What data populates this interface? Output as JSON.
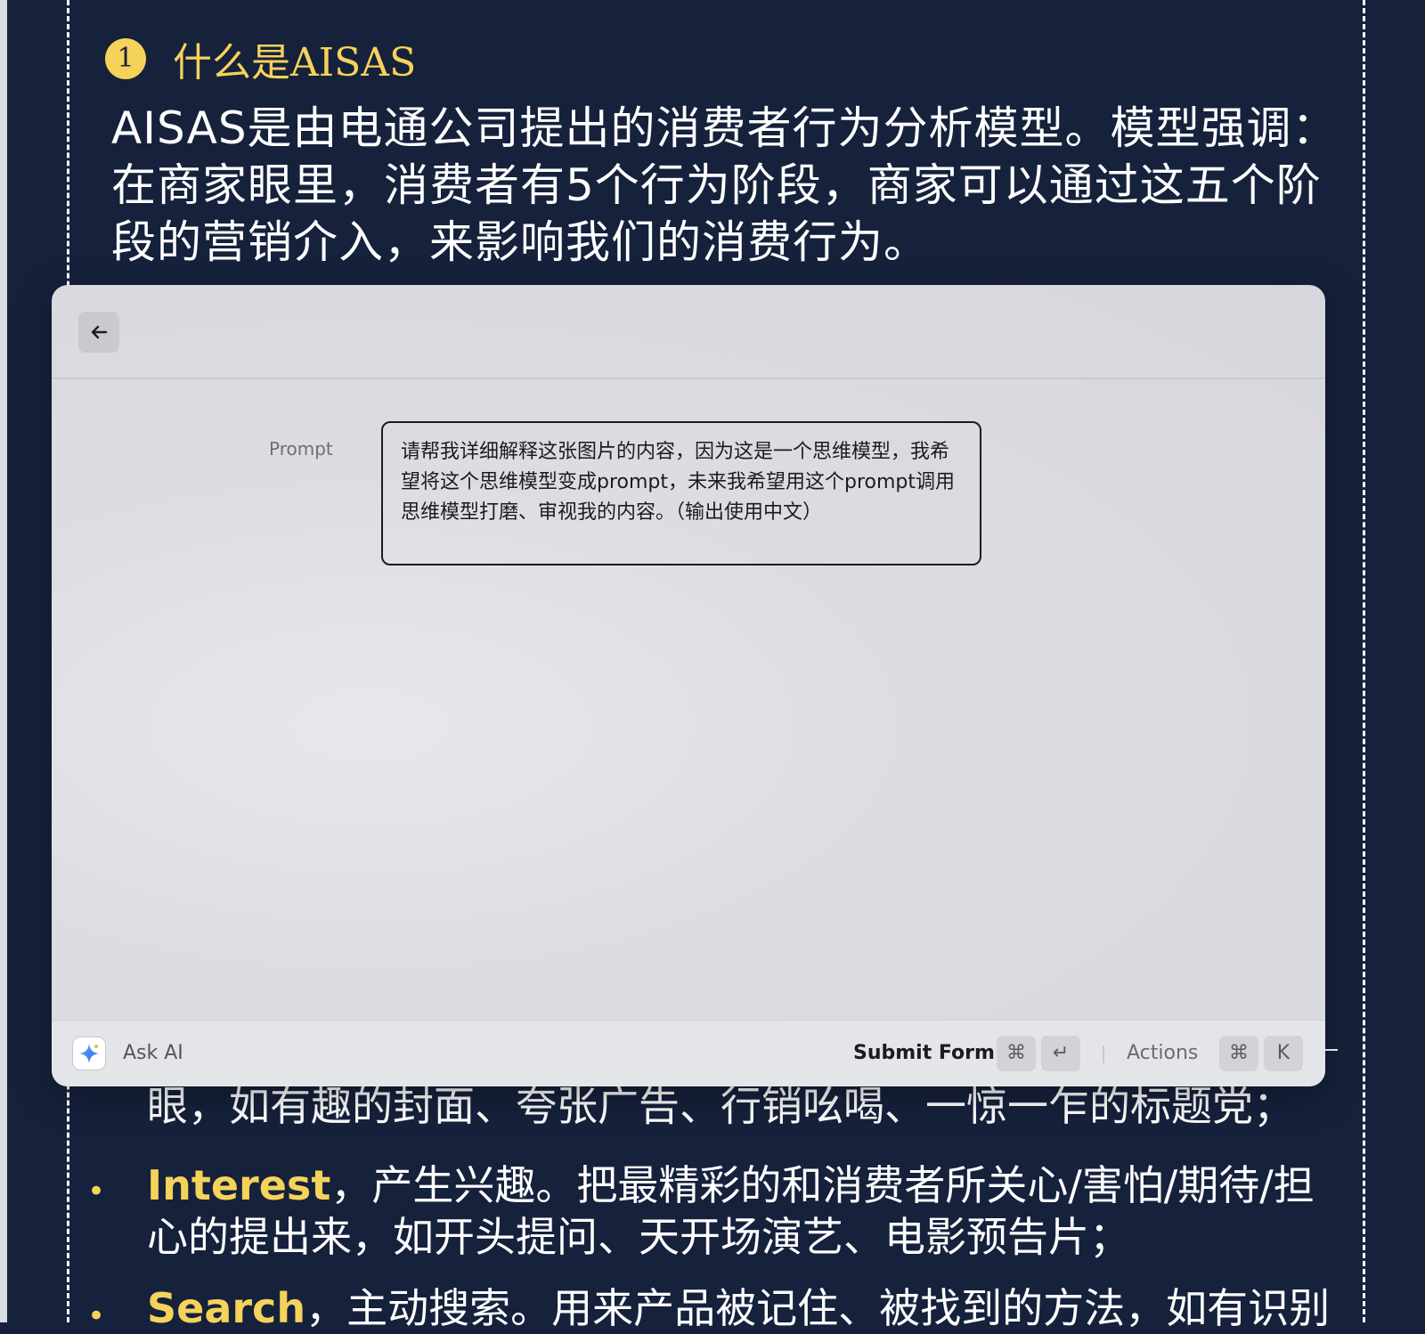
{
  "document": {
    "section_number": "1",
    "section_title": "什么是AISAS",
    "intro": "AISAS是由电通公司提出的消费者行为分析模型。模型强调：在商家眼里，消费者有5个行为阶段，商家可以通过这五个阶段的营销介入，来影响我们的消费行为。",
    "partial_line": "眼，如有趣的封面、夸张广告、行销吆喝、一惊一乍的标题党；",
    "bullets": [
      {
        "keyword": "Interest",
        "text": "，产生兴趣。把最精彩的和消费者所关心/害怕/期待/担心的提出来，如开头提问、天开场演艺、电影预告片；"
      },
      {
        "keyword": "Search",
        "text": "，主动搜索。用来产品被记住、被找到的方法，如有识别"
      }
    ]
  },
  "window": {
    "prompt_label": "Prompt",
    "prompt_value": "请帮我详细解释这张图片的内容，因为这是一个思维模型，我希望将这个思维模型变成prompt，未来我希望用这个prompt调用思维模型打磨、审视我的内容。（输出使用中文）",
    "footer": {
      "ask_ai": "Ask AI",
      "submit_form": "Submit Form",
      "submit_keys": [
        "⌘",
        "↵"
      ],
      "actions": "Actions",
      "actions_keys": [
        "⌘",
        "K"
      ]
    }
  },
  "colors": {
    "doc_background": "#16213c",
    "accent_yellow": "#f5d35a",
    "window_bg": "#dcdde2"
  }
}
